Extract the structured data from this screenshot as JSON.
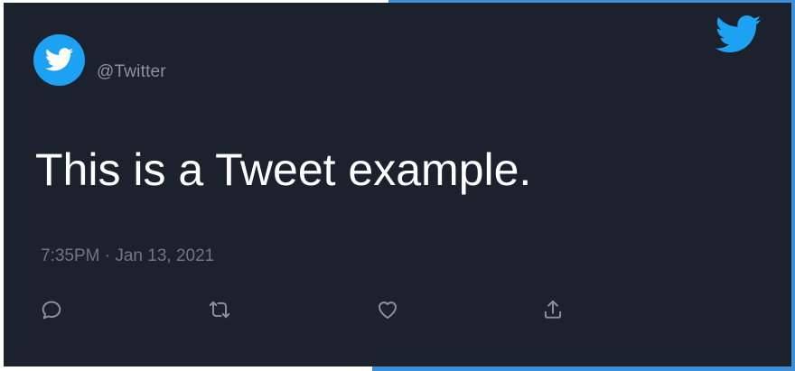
{
  "tweet": {
    "handle": "@Twitter",
    "text": "This is a Tweet example.",
    "timestamp": "7:35PM · Jan 13, 2021"
  },
  "icons": {
    "avatar": "twitter-bird-icon",
    "brand": "twitter-bird-icon",
    "actions": [
      "reply-icon",
      "retweet-icon",
      "like-icon",
      "share-icon"
    ]
  },
  "colors": {
    "card_background": "#1b222d",
    "brand_blue": "#1da1f2",
    "handle": "#8a939c",
    "timestamp": "#6e7780",
    "action_icons": "#8a939c",
    "frame_accent": "#3d8fd8"
  }
}
